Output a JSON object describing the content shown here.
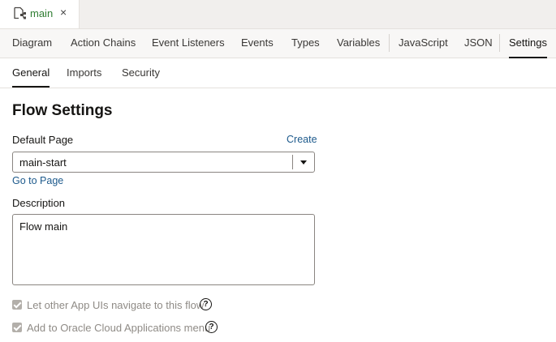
{
  "file_tab": {
    "name": "main",
    "close": "×",
    "icon": "flow-file-icon"
  },
  "editor_tabs": [
    {
      "label": "Diagram"
    },
    {
      "label": "Action Chains"
    },
    {
      "label": "Event Listeners"
    },
    {
      "label": "Events"
    },
    {
      "label": "Types"
    },
    {
      "label": "Variables"
    },
    {
      "label": "JavaScript"
    },
    {
      "label": "JSON"
    },
    {
      "label": "Settings",
      "active": true
    }
  ],
  "sub_tabs": [
    {
      "label": "General",
      "active": true
    },
    {
      "label": "Imports"
    },
    {
      "label": "Security"
    }
  ],
  "main": {
    "title": "Flow Settings",
    "default_page": {
      "label": "Default Page",
      "create_link": "Create",
      "value": "main-start",
      "goto_link": "Go to Page"
    },
    "description": {
      "label": "Description",
      "value": "Flow main"
    },
    "checkboxes": [
      {
        "label": "Let other App UIs navigate to this flow",
        "checked": true,
        "disabled": true,
        "help": "?"
      },
      {
        "label": "Add to Oracle Cloud Applications menu",
        "checked": true,
        "disabled": true,
        "help": "?"
      }
    ]
  },
  "colors": {
    "accent": "#161513",
    "link": "#1d5a8c",
    "file_name": "#2f7d32"
  }
}
